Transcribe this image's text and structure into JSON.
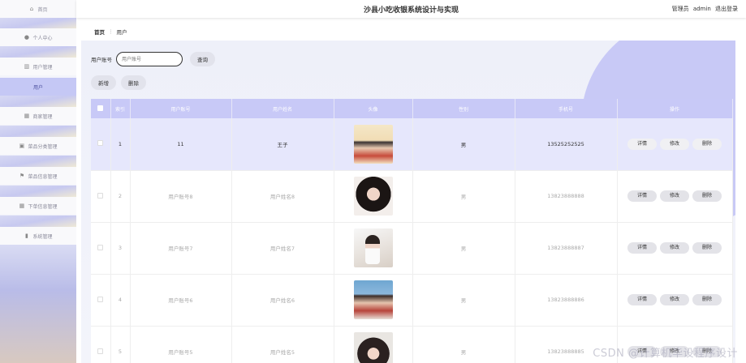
{
  "app": {
    "title": "沙县小吃收银系统设计与实现",
    "user_role": "管理员",
    "user_name": "admin",
    "logout_label": "退出登录"
  },
  "sidebar": {
    "items": [
      {
        "label": "首页",
        "icon": "home-icon"
      },
      {
        "label": "个人中心",
        "icon": "user-icon"
      },
      {
        "label": "用户管理",
        "icon": "bank-icon"
      },
      {
        "label": "用户",
        "icon": "",
        "active": true
      },
      {
        "label": "商家管理",
        "icon": "grid-icon"
      },
      {
        "label": "菜品分类管理",
        "icon": "shop-icon"
      },
      {
        "label": "菜品信息管理",
        "icon": "flag-icon"
      },
      {
        "label": "下单信息管理",
        "icon": "grid-icon"
      },
      {
        "label": "系统管理",
        "icon": "chart-icon"
      }
    ]
  },
  "breadcrumb": {
    "home": "首页",
    "separator": "⋮",
    "current": "用户"
  },
  "search": {
    "label": "用户账号",
    "placeholder": "用户账号",
    "button": "查询"
  },
  "actions": {
    "add": "新增",
    "delete": "删除"
  },
  "table": {
    "headers": [
      "索引",
      "用户账号",
      "用户姓名",
      "头像",
      "性别",
      "手机号",
      "操作"
    ],
    "row_buttons": {
      "detail": "详情",
      "edit": "修改",
      "delete": "删除"
    },
    "rows": [
      {
        "index": "1",
        "account": "11",
        "name": "王子",
        "gender": "男",
        "phone": "13525252525"
      },
      {
        "index": "2",
        "account": "用户账号8",
        "name": "用户姓名8",
        "gender": "男",
        "phone": "13823888888"
      },
      {
        "index": "3",
        "account": "用户账号7",
        "name": "用户姓名7",
        "gender": "男",
        "phone": "13823888887"
      },
      {
        "index": "4",
        "account": "用户账号6",
        "name": "用户姓名6",
        "gender": "男",
        "phone": "13823888886"
      },
      {
        "index": "5",
        "account": "用户账号5",
        "name": "用户姓名5",
        "gender": "男",
        "phone": "13823888885"
      }
    ]
  },
  "watermark": "CSDN @计算机毕设程序设计",
  "colors": {
    "accent": "#c8c9f7",
    "highlight_row": "#e6e7fc"
  }
}
